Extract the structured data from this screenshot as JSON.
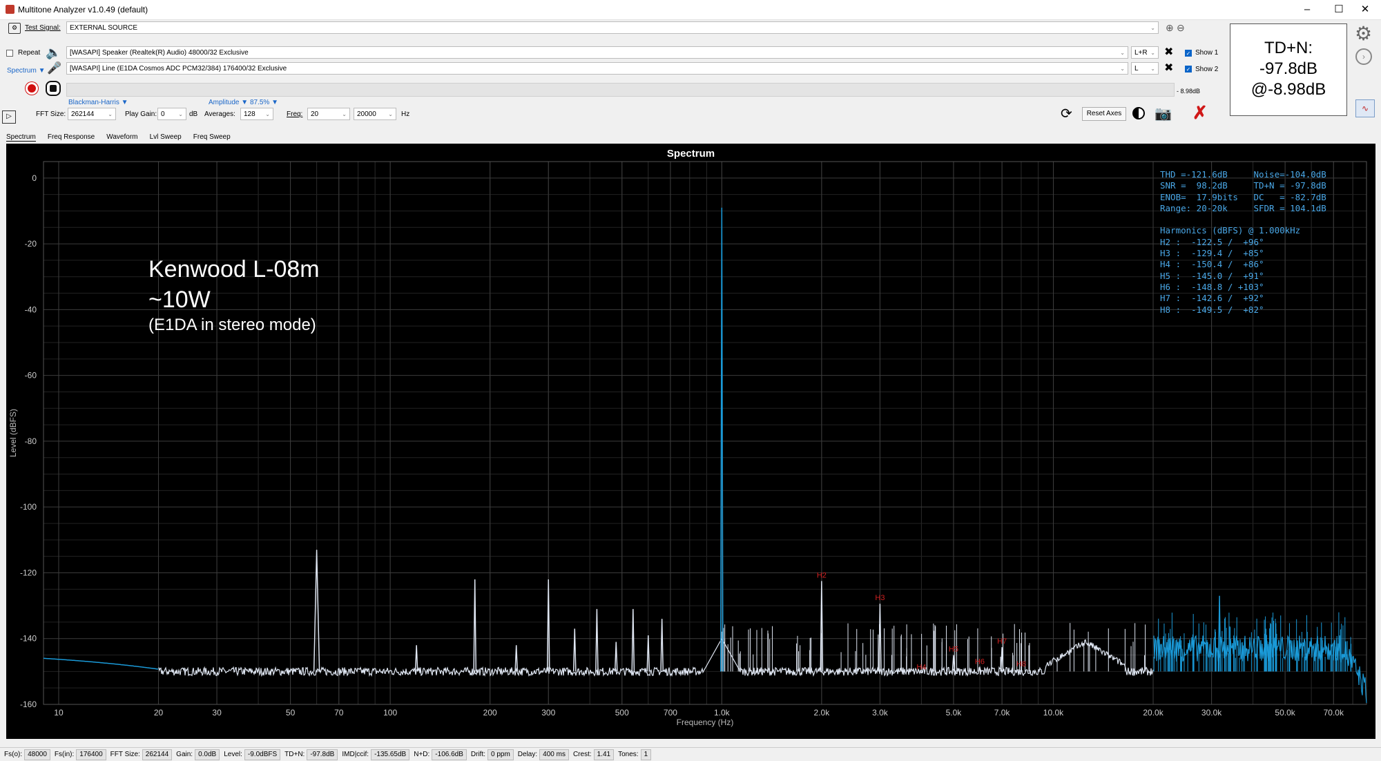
{
  "window": {
    "title": "Multitone Analyzer v1.0.49 (default)"
  },
  "toolbar": {
    "test_signal_label": "Test Signal:",
    "test_signal_value": "EXTERNAL SOURCE",
    "repeat_label": "Repeat",
    "spectrum_menu": "Spectrum",
    "output_device": "[WASAPI] Speaker (Realtek(R) Audio) 48000/32 Exclusive",
    "input_device": "[WASAPI] Line (E1DA Cosmos ADC PCM32/384) 176400/32 Exclusive",
    "output_channel": "L+R",
    "input_channel": "L",
    "show1_label": "Show 1",
    "show2_label": "Show 2",
    "level_readout": "- 8.98dB",
    "window_fn": "Blackman-Harris",
    "amplitude_label": "Amplitude",
    "amplitude_value": "87.5%",
    "fft_size_label": "FFT Size:",
    "fft_size_value": "262144",
    "play_gain_label": "Play Gain:",
    "play_gain_value": "0",
    "play_gain_unit": "dB",
    "averages_label": "Averages:",
    "averages_value": "128",
    "freq_label": "Freq:",
    "freq_from": "20",
    "freq_to": "20000",
    "freq_unit": "Hz",
    "reset_axes_label": "Reset Axes"
  },
  "tdn_box": {
    "line1": "TD+N:",
    "line2": "-97.8dB",
    "line3": "@-8.98dB"
  },
  "tabs": [
    "Spectrum",
    "Freq Response",
    "Waveform",
    "Lvl Sweep",
    "Freq Sweep"
  ],
  "annotation": {
    "line1": "Kenwood L-08m",
    "line2": "~10W",
    "line3": "(E1DA in stereo mode)"
  },
  "stats": {
    "lines": [
      "THD =-121.6dB     Noise=-104.0dB",
      "SNR =  98.2dB     TD+N = -97.8dB",
      "ENOB=  17.9bits   DC   = -82.7dB",
      "Range: 20-20k     SFDR = 104.1dB",
      "",
      "Harmonics (dBFS) @ 1.000kHz",
      "H2 :  -122.5 /  +96°",
      "H3 :  -129.4 /  +85°",
      "H4 :  -150.4 /  +86°",
      "H5 :  -145.0 /  +91°",
      "H6 :  -148.8 / +103°",
      "H7 :  -142.6 /  +92°",
      "H8 :  -149.5 /  +82°"
    ]
  },
  "status": [
    {
      "label": "Fs(o):",
      "value": "48000"
    },
    {
      "label": "Fs(in):",
      "value": "176400"
    },
    {
      "label": "FFT Size:",
      "value": "262144"
    },
    {
      "label": "Gain:",
      "value": "0.0dB"
    },
    {
      "label": "Level:",
      "value": "-9.0dBFS"
    },
    {
      "label": "TD+N:",
      "value": "-97.8dB"
    },
    {
      "label": "IMD|ccif:",
      "value": "-135.65dB"
    },
    {
      "label": "N+D:",
      "value": "-106.6dB"
    },
    {
      "label": "Drift:",
      "value": "0  ppm"
    },
    {
      "label": "Delay:",
      "value": "400  ms"
    },
    {
      "label": "Crest:",
      "value": "1.41"
    },
    {
      "label": "Tones:",
      "value": "1"
    }
  ],
  "chart_data": {
    "type": "line",
    "title": "Spectrum",
    "xlabel": "Frequency (Hz)",
    "ylabel": "Level (dBFS)",
    "xscale": "log",
    "xlim": [
      9,
      88000
    ],
    "ylim": [
      -160,
      5
    ],
    "xticks": [
      10,
      20,
      30,
      50,
      70,
      100,
      200,
      300,
      500,
      700,
      1000,
      2000,
      3000,
      5000,
      7000,
      10000,
      20000,
      30000,
      50000,
      70000
    ],
    "xtick_labels": [
      "10",
      "20",
      "30",
      "50",
      "70",
      "100",
      "200",
      "300",
      "500",
      "700",
      "1.0k",
      "2.0k",
      "3.0k",
      "5.0k",
      "7.0k",
      "10.0k",
      "20.0k",
      "30.0k",
      "50.0k",
      "70.0k"
    ],
    "yticks": [
      0,
      -20,
      -40,
      -60,
      -80,
      -100,
      -120,
      -140,
      -160
    ],
    "noise_floor_db": -150,
    "in_band_color": "#dfe6f2",
    "out_band_color": "#1a9ad8",
    "peaks": [
      {
        "f": 60,
        "db": -113
      },
      {
        "f": 120,
        "db": -142
      },
      {
        "f": 180,
        "db": -122
      },
      {
        "f": 240,
        "db": -142
      },
      {
        "f": 300,
        "db": -122
      },
      {
        "f": 360,
        "db": -137
      },
      {
        "f": 420,
        "db": -131
      },
      {
        "f": 480,
        "db": -141
      },
      {
        "f": 540,
        "db": -131
      },
      {
        "f": 600,
        "db": -139
      },
      {
        "f": 660,
        "db": -134
      },
      {
        "f": 1000,
        "db": -9
      },
      {
        "f": 2000,
        "db": -122.5
      },
      {
        "f": 3000,
        "db": -129.4
      },
      {
        "f": 4000,
        "db": -150.4
      },
      {
        "f": 5000,
        "db": -145.0
      },
      {
        "f": 6000,
        "db": -148.8
      },
      {
        "f": 7000,
        "db": -142.6
      },
      {
        "f": 8000,
        "db": -149.5
      },
      {
        "f": 31700,
        "db": -127
      }
    ],
    "harmonic_labels": [
      {
        "label": "H2",
        "f": 2000,
        "db": -122.5
      },
      {
        "label": "H3",
        "f": 3000,
        "db": -129.4
      },
      {
        "label": "H4",
        "f": 4000,
        "db": -150.4
      },
      {
        "label": "H5",
        "f": 5000,
        "db": -145.0
      },
      {
        "label": "H6",
        "f": 6000,
        "db": -148.8
      },
      {
        "label": "H7",
        "f": 7000,
        "db": -142.6
      },
      {
        "label": "H8",
        "f": 8000,
        "db": -149.5
      }
    ]
  }
}
